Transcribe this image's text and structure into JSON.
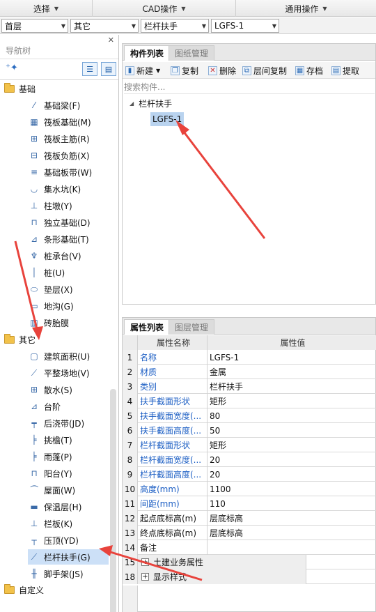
{
  "menubar": {
    "select": "选择",
    "cad": "CAD操作",
    "general": "通用操作"
  },
  "combos": {
    "floor": "首层",
    "category": "其它",
    "component_type": "栏杆扶手",
    "component": "LGFS-1"
  },
  "nav": {
    "title": "导航树",
    "groups": [
      {
        "label": "基础",
        "items": [
          {
            "label": "基础梁(F)",
            "icon": "beam-icon"
          },
          {
            "label": "筏板基础(M)",
            "icon": "raft-icon"
          },
          {
            "label": "筏板主筋(R)",
            "icon": "main-rebar-icon"
          },
          {
            "label": "筏板负筋(X)",
            "icon": "neg-rebar-icon"
          },
          {
            "label": "基础板带(W)",
            "icon": "strip-icon"
          },
          {
            "label": "集水坑(K)",
            "icon": "sump-icon"
          },
          {
            "label": "柱墩(Y)",
            "icon": "pier-icon"
          },
          {
            "label": "独立基础(D)",
            "icon": "isolated-footing-icon"
          },
          {
            "label": "条形基础(T)",
            "icon": "strip-footing-icon"
          },
          {
            "label": "桩承台(V)",
            "icon": "pile-cap-icon"
          },
          {
            "label": "桩(U)",
            "icon": "pile-icon"
          },
          {
            "label": "垫层(X)",
            "icon": "cushion-icon"
          },
          {
            "label": "地沟(G)",
            "icon": "trench-icon"
          },
          {
            "label": "砖胎膜",
            "icon": "brick-mold-icon"
          }
        ]
      },
      {
        "label": "其它",
        "items": [
          {
            "label": "建筑面积(U)",
            "icon": "area-icon"
          },
          {
            "label": "平整场地(V)",
            "icon": "leveling-icon"
          },
          {
            "label": "散水(S)",
            "icon": "apron-icon"
          },
          {
            "label": "台阶",
            "icon": "steps-icon"
          },
          {
            "label": "后浇带(JD)",
            "icon": "post-pour-icon"
          },
          {
            "label": "挑檐(T)",
            "icon": "cornice-icon"
          },
          {
            "label": "雨蓬(P)",
            "icon": "canopy-icon"
          },
          {
            "label": "阳台(Y)",
            "icon": "balcony-icon"
          },
          {
            "label": "屋面(W)",
            "icon": "roof-icon"
          },
          {
            "label": "保温层(H)",
            "icon": "insulation-icon"
          },
          {
            "label": "栏板(K)",
            "icon": "parapet-icon"
          },
          {
            "label": "压顶(YD)",
            "icon": "coping-icon"
          },
          {
            "label": "栏杆扶手(G)",
            "icon": "railing-icon"
          },
          {
            "label": "脚手架(JS)",
            "icon": "scaffold-icon"
          }
        ]
      },
      {
        "label": "自定义",
        "items": []
      }
    ]
  },
  "component_panel": {
    "tab_active": "构件列表",
    "tab_inactive": "图纸管理",
    "toolbar": {
      "new": "新建",
      "copy": "复制",
      "delete": "删除",
      "floor_copy": "层间复制",
      "save": "存档",
      "extract": "提取"
    },
    "search_placeholder": "搜索构件...",
    "tree_parent": "栏杆扶手",
    "tree_child": "LGFS-1"
  },
  "property_panel": {
    "tab_active": "属性列表",
    "tab_inactive": "图层管理",
    "col_name": "属性名称",
    "col_value": "属性值",
    "rows": [
      {
        "num": "1",
        "name": "名称",
        "value": "LGFS-1",
        "blue": true
      },
      {
        "num": "2",
        "name": "材质",
        "value": "金属",
        "blue": true
      },
      {
        "num": "3",
        "name": "类别",
        "value": "栏杆扶手",
        "blue": true
      },
      {
        "num": "4",
        "name": "扶手截面形状",
        "value": "矩形",
        "blue": true
      },
      {
        "num": "5",
        "name": "扶手截面宽度(...",
        "value": "80",
        "blue": true
      },
      {
        "num": "6",
        "name": "扶手截面高度(...",
        "value": "50",
        "blue": true
      },
      {
        "num": "7",
        "name": "栏杆截面形状",
        "value": "矩形",
        "blue": true
      },
      {
        "num": "8",
        "name": "栏杆截面宽度(...",
        "value": "20",
        "blue": true
      },
      {
        "num": "9",
        "name": "栏杆截面高度(...",
        "value": "20",
        "blue": true
      },
      {
        "num": "10",
        "name": "高度(mm)",
        "value": "1100",
        "blue": true
      },
      {
        "num": "11",
        "name": "间距(mm)",
        "value": "110",
        "blue": true
      },
      {
        "num": "12",
        "name": "起点底标高(m)",
        "value": "层底标高",
        "blue": false
      },
      {
        "num": "13",
        "name": "终点底标高(m)",
        "value": "层底标高",
        "blue": false
      },
      {
        "num": "14",
        "name": "备注",
        "value": "",
        "blue": false
      }
    ],
    "groups": [
      {
        "num": "15",
        "label": "土建业务属性"
      },
      {
        "num": "18",
        "label": "显示样式"
      }
    ]
  },
  "colors": {
    "arrow": "#e8433c",
    "selection": "#cce0f7",
    "link_blue": "#1d5fc4"
  }
}
